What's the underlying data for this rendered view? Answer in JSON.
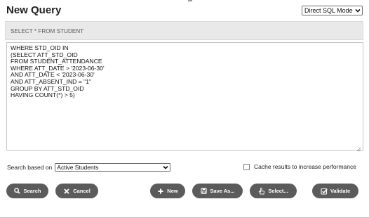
{
  "header": {
    "title": "New Query",
    "mode_select": {
      "value": "Direct SQL Mode",
      "icon": "chevron-down-icon"
    }
  },
  "base_query": "SELECT * FROM STUDENT",
  "sql_editor": {
    "text": "WHERE STD_OID IN\n(SELECT ATT_STD_OID\nFROM STUDENT_ATTENDANCE\nWHERE ATT_DATE > '2023-06-30'\nAND ATT_DATE < '2023-06-30'\nAND ATT_ABSENT_IND = \"1\"\nGROUP BY ATT_STD_OID\nHAVING COUNT(*) > 5)"
  },
  "search_based": {
    "label": "Search based on",
    "value": "Active Students"
  },
  "cache": {
    "label": "Cache results to increase performance",
    "checked": false
  },
  "buttons": {
    "search": {
      "label": "Search",
      "icon": "search-icon"
    },
    "cancel": {
      "label": "Cancel",
      "icon": "close-icon"
    },
    "new": {
      "label": "New",
      "icon": "plus-icon"
    },
    "save_as": {
      "label": "Save As...",
      "icon": "save-icon"
    },
    "select": {
      "label": "Select...",
      "icon": "hand-pointer-icon"
    },
    "validate": {
      "label": "Validate",
      "icon": "check-square-icon"
    }
  },
  "colors": {
    "button_bg": "#5b5b5b",
    "base_query_bg": "#e9e9e9"
  }
}
